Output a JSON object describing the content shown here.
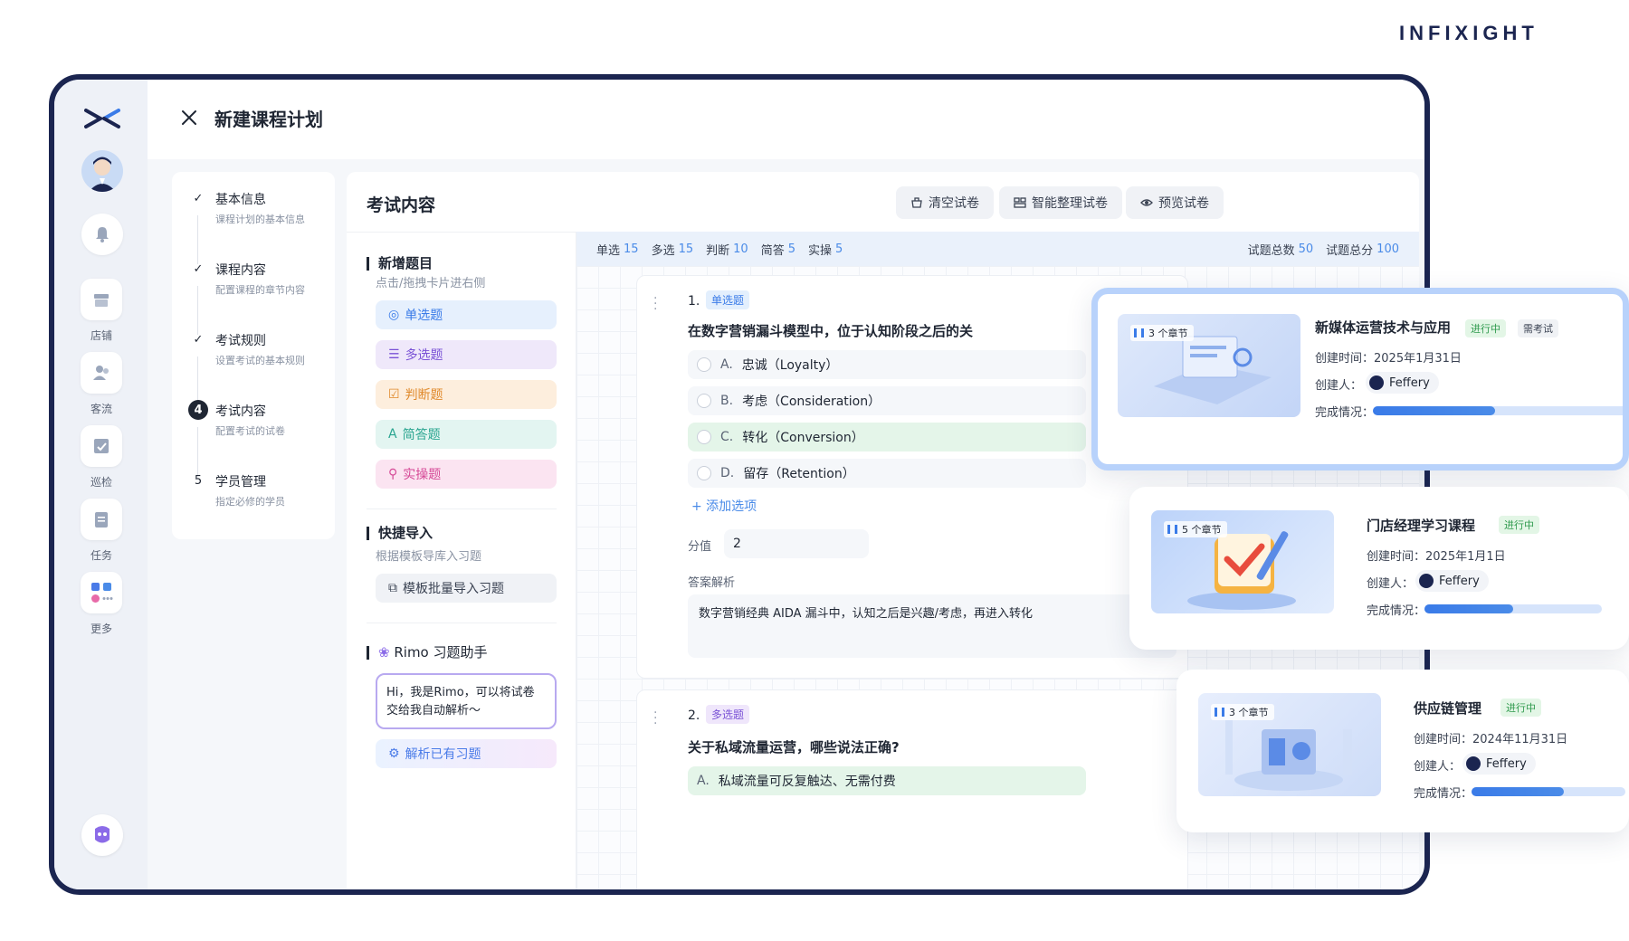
{
  "brand": "INFIXIGHT",
  "header": {
    "title": "新建课程计划"
  },
  "rail": {
    "items": [
      {
        "label": "店铺",
        "icon": "store-icon"
      },
      {
        "label": "客流",
        "icon": "customers-icon"
      },
      {
        "label": "巡检",
        "icon": "inspection-icon"
      },
      {
        "label": "任务",
        "icon": "task-icon"
      },
      {
        "label": "更多",
        "icon": "apps-icon"
      }
    ]
  },
  "steps": [
    {
      "title": "基本信息",
      "sub": "课程计划的基本信息",
      "mark": "✓"
    },
    {
      "title": "课程内容",
      "sub": "配置课程的章节内容",
      "mark": "✓"
    },
    {
      "title": "考试规则",
      "sub": "设置考试的基本规则",
      "mark": "✓"
    },
    {
      "title": "考试内容",
      "sub": "配置考试的试卷",
      "mark": "4"
    },
    {
      "title": "学员管理",
      "sub": "指定必修的学员",
      "mark": "5"
    }
  ],
  "panel": {
    "title": "考试内容",
    "buttons": {
      "clear": "清空试卷",
      "smart": "智能整理试卷",
      "preview": "预览试卷"
    }
  },
  "add_section": {
    "title": "新增题目",
    "sub": "点击/拖拽卡片进右侧",
    "types": [
      "单选题",
      "多选题",
      "判断题",
      "简答题",
      "实操题"
    ]
  },
  "import_section": {
    "title": "快捷导入",
    "sub": "根据模板导库入习题",
    "button": "模板批量导入习题"
  },
  "assistant": {
    "title": "Rimo 习题助手",
    "bubble": "Hi，我是Rimo，可以将试卷交给我自动解析～",
    "button": "解析已有习题"
  },
  "stats": {
    "single_label": "单选",
    "single": "15",
    "multi_label": "多选",
    "multi": "15",
    "judge_label": "判断",
    "judge": "10",
    "short_label": "简答",
    "short": "5",
    "practice_label": "实操",
    "practice": "5",
    "total_label": "试题总数",
    "total": "50",
    "score_label": "试题总分",
    "score": "100"
  },
  "q1": {
    "no": "1.",
    "tag": "单选题",
    "text": "在数字营销漏斗模型中，位于认知阶段之后的关",
    "options": [
      {
        "letter": "A.",
        "text": "忠诚（Loyalty）"
      },
      {
        "letter": "B.",
        "text": "考虑（Consideration）"
      },
      {
        "letter": "C.",
        "text": "转化（Conversion）"
      },
      {
        "letter": "D.",
        "text": "留存（Retention）"
      }
    ],
    "add_option": "+ 添加选项",
    "score_label": "分值",
    "score": "2",
    "answer_label": "答案解析",
    "answer": "数字营销经典 AIDA 漏斗中，认知之后是兴趣/考虑，再进入转化"
  },
  "q2": {
    "no": "2.",
    "tag": "多选题",
    "text": "关于私域流量运营，哪些说法正确?",
    "option_a": {
      "letter": "A.",
      "text": "私域流量可反复触达、无需付费"
    }
  },
  "courses": [
    {
      "chapters": "3 个章节",
      "title": "新媒体运营技术与应用",
      "status": "进行中",
      "exam": "需考试",
      "created_label": "创建时间：",
      "created": "2025年1月31日",
      "creator_label": "创建人：",
      "creator": "Feffery",
      "progress_label": "完成情况：",
      "progress": 0.45
    },
    {
      "chapters": "5 个章节",
      "title": "门店经理学习课程",
      "status": "进行中",
      "created_label": "创建时间：",
      "created": "2025年1月1日",
      "creator_label": "创建人：",
      "creator": "Feffery",
      "progress_label": "完成情况：",
      "progress": 0.5
    },
    {
      "chapters": "3 个章节",
      "title": "供应链管理",
      "status": "进行中",
      "created_label": "创建时间：",
      "created": "2024年11月31日",
      "creator_label": "创建人：",
      "creator": "Feffery",
      "progress_label": "完成情况：",
      "progress": 0.6
    }
  ],
  "colors": {
    "accent": "#4a8be8",
    "frame": "#1b2550",
    "correct": "#e4f5e9"
  }
}
